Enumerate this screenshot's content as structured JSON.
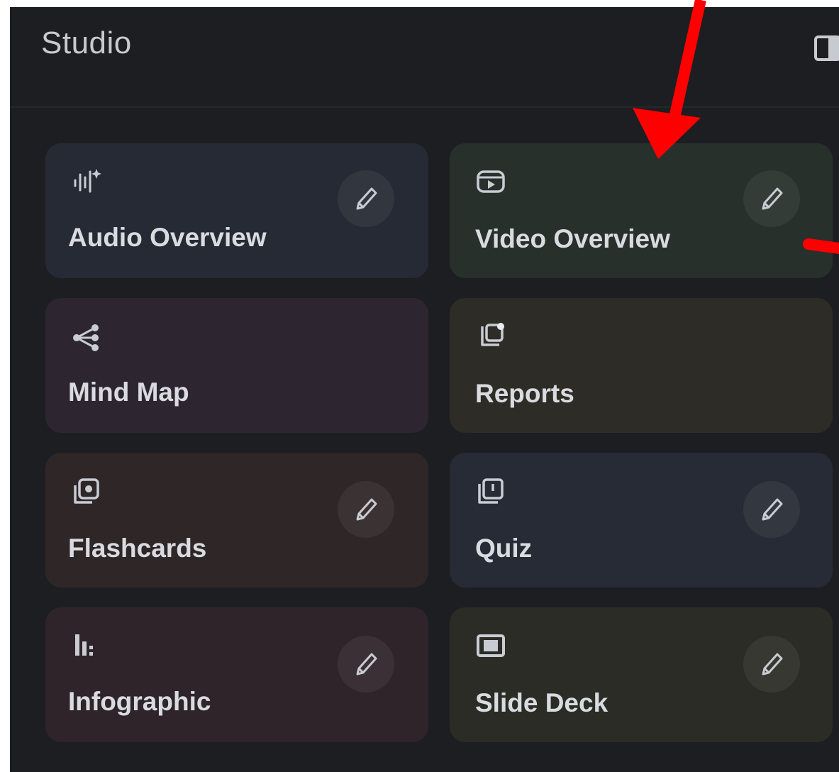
{
  "panel": {
    "title": "Studio",
    "toggle_icon": "panel-layout-icon"
  },
  "cards": [
    {
      "label": "Audio Overview",
      "icon": "audio-waveform-icon",
      "editable": true,
      "bg": "#262a34"
    },
    {
      "label": "Video Overview",
      "icon": "video-play-icon",
      "editable": true,
      "bg": "#28302b"
    },
    {
      "label": "Mind Map",
      "icon": "mind-map-icon",
      "editable": false,
      "bg": "#2d2530"
    },
    {
      "label": "Reports",
      "icon": "reports-icon",
      "editable": false,
      "bg": "#2d2c27"
    },
    {
      "label": "Flashcards",
      "icon": "flashcards-icon",
      "editable": true,
      "bg": "#2f2628"
    },
    {
      "label": "Quiz",
      "icon": "quiz-icon",
      "editable": true,
      "bg": "#262b35"
    },
    {
      "label": "Infographic",
      "icon": "infographic-icon",
      "editable": true,
      "bg": "#2e2429"
    },
    {
      "label": "Slide Deck",
      "icon": "slide-deck-icon",
      "editable": true,
      "bg": "#2a2c25"
    }
  ],
  "edit_icon": "pencil-icon",
  "annotation": {
    "color": "#ff0000",
    "marks": [
      "arrow-down-to-video-overview",
      "arrow-from-right-edge"
    ]
  }
}
